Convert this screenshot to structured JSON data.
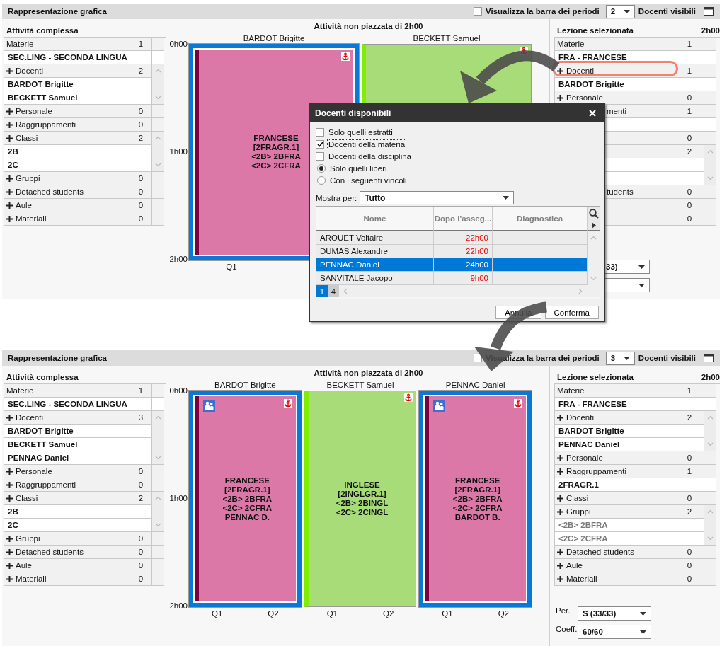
{
  "panels": [
    {
      "title": "Rappresentazione grafica",
      "periods_bar": {
        "label": "Visualizza la barra dei periodi",
        "checked": false
      },
      "teachers_count": "2",
      "teachers_label": "Docenti visibili",
      "left": {
        "title": "Attività complessa",
        "sections": [
          {
            "label": "Materie",
            "plus": false,
            "count": "1",
            "scroll": false,
            "items": [
              {
                "text": "SEC.LING - SECONDA LINGUA"
              }
            ]
          },
          {
            "label": "Docenti",
            "plus": true,
            "count": "2",
            "scroll": true,
            "items": [
              {
                "text": "BARDOT Brigitte"
              },
              {
                "text": "BECKETT Samuel"
              }
            ]
          },
          {
            "label": "Personale",
            "plus": true,
            "count": "0",
            "scroll": false
          },
          {
            "label": "Raggruppamenti",
            "plus": true,
            "count": "0",
            "scroll": false
          },
          {
            "label": "Classi",
            "plus": true,
            "count": "2",
            "scroll": true,
            "items": [
              {
                "text": "2B"
              },
              {
                "text": "2C"
              }
            ]
          },
          {
            "label": "Gruppi",
            "plus": true,
            "count": "0",
            "scroll": false
          },
          {
            "label": "Detached students",
            "plus": true,
            "count": "0",
            "scroll": false
          },
          {
            "label": "Aule",
            "plus": true,
            "count": "0",
            "scroll": false
          },
          {
            "label": "Materiali",
            "plus": true,
            "count": "0",
            "scroll": false
          }
        ]
      },
      "middle": {
        "title": "Attività non piazzata di 2h00",
        "times": [
          "0h00",
          "1h00",
          "2h00"
        ],
        "columns": [
          {
            "name": "BARDOT Brigitte",
            "block": {
              "kind": "framed",
              "color": "#dc78a8",
              "anchored": true,
              "group": false,
              "lines": [
                "FRANCESE",
                "[2FRAGR.1]",
                "<2B> 2BFRA",
                "<2C> 2CFRA"
              ]
            },
            "periods": [
              "Q1"
            ]
          },
          {
            "name": "BECKETT Samuel",
            "block": {
              "kind": "plain",
              "color": "#a8dc78",
              "anchored": true,
              "group": false
            }
          }
        ]
      },
      "right": {
        "title": "Lezione selezionata",
        "duration": "2h00",
        "sections": [
          {
            "label": "Materie",
            "plus": false,
            "covered": false,
            "count": "1",
            "scroll": false,
            "items": [
              {
                "text": "FRA - FRANCESE"
              }
            ]
          },
          {
            "label": "Docenti",
            "plus": true,
            "covered": false,
            "count": "1",
            "scroll": false,
            "items": [
              {
                "text": "BARDOT Brigitte"
              }
            ]
          },
          {
            "label": "Personale",
            "plus": true,
            "covered": false,
            "count": "0",
            "scroll": false
          },
          {
            "label": "menti",
            "covered": true,
            "count": "1",
            "scroll": false,
            "items": [
              {
                "kind": "hidden"
              }
            ]
          },
          {
            "count": "0",
            "scroll": false
          },
          {
            "count": "2",
            "scroll": true,
            "items": [
              {
                "kind": "hidden"
              },
              {
                "kind": "hidden"
              }
            ]
          },
          {
            "label": "tudents",
            "covered": true,
            "count": "0",
            "scroll": false
          },
          {
            "count": "0",
            "scroll": false
          },
          {
            "count": "0",
            "scroll": false
          }
        ],
        "fields": [
          {
            "covered": true,
            "value": "33)"
          },
          {
            "covered": true
          }
        ]
      }
    },
    {
      "title": "Rappresentazione grafica",
      "periods_bar": {
        "label": "Visualizza la barra dei periodi",
        "checked": false
      },
      "teachers_count": "3",
      "teachers_label": "Docenti visibili",
      "left": {
        "title": "Attività complessa",
        "sections": [
          {
            "label": "Materie",
            "plus": false,
            "count": "1",
            "scroll": false,
            "items": [
              {
                "text": "SEC.LING - SECONDA LINGUA"
              }
            ]
          },
          {
            "label": "Docenti",
            "plus": true,
            "count": "3",
            "scroll": true,
            "items": [
              {
                "text": "BARDOT Brigitte"
              },
              {
                "text": "BECKETT Samuel"
              },
              {
                "text": "PENNAC Daniel"
              }
            ]
          },
          {
            "label": "Personale",
            "plus": true,
            "count": "0",
            "scroll": false
          },
          {
            "label": "Raggruppamenti",
            "plus": true,
            "count": "0",
            "scroll": false
          },
          {
            "label": "Classi",
            "plus": true,
            "count": "2",
            "scroll": true,
            "items": [
              {
                "text": "2B"
              },
              {
                "text": "2C"
              }
            ]
          },
          {
            "label": "Gruppi",
            "plus": true,
            "count": "0",
            "scroll": false
          },
          {
            "label": "Detached students",
            "plus": true,
            "count": "0",
            "scroll": false
          },
          {
            "label": "Aule",
            "plus": true,
            "count": "0",
            "scroll": false
          },
          {
            "label": "Materiali",
            "plus": true,
            "count": "0",
            "scroll": false
          }
        ]
      },
      "middle": {
        "title": "Attività non piazzata di 2h00",
        "times": [
          "0h00",
          "1h00",
          "2h00"
        ],
        "columns": [
          {
            "name": "BARDOT Brigitte",
            "block": {
              "kind": "framed",
              "color": "#dc78a8",
              "anchored": true,
              "group": true,
              "lines": [
                "FRANCESE",
                "[2FRAGR.1]",
                "<2B> 2BFRA",
                "<2C> 2CFRA",
                "PENNAC D."
              ]
            },
            "periods": [
              "Q1",
              "Q2"
            ]
          },
          {
            "name": "BECKETT Samuel",
            "block": {
              "kind": "plain",
              "color": "#a8dc78",
              "anchored": true,
              "group": false,
              "lines": [
                "INGLESE",
                "[2INGLGR.1]",
                "<2B> 2BINGL",
                "<2C> 2CINGL"
              ]
            },
            "periods": [
              "Q1",
              "Q2"
            ]
          },
          {
            "name": "PENNAC Daniel",
            "block": {
              "kind": "framed",
              "color": "#dc78a8",
              "anchored": true,
              "group": true,
              "lines": [
                "FRANCESE",
                "[2FRAGR.1]",
                "<2B> 2BFRA",
                "<2C> 2CFRA",
                "BARDOT B."
              ]
            },
            "periods": [
              "Q1",
              "Q2"
            ]
          }
        ]
      },
      "right": {
        "title": "Lezione selezionata",
        "duration": "2h00",
        "sections": [
          {
            "label": "Materie",
            "plus": false,
            "covered": false,
            "count": "1",
            "scroll": false,
            "items": [
              {
                "text": "FRA - FRANCESE",
                "muted": false
              }
            ]
          },
          {
            "label": "Docenti",
            "plus": true,
            "covered": false,
            "count": "2",
            "scroll": true,
            "items": [
              {
                "text": "BARDOT Brigitte",
                "muted": false
              },
              {
                "text": "PENNAC Daniel",
                "muted": false
              }
            ]
          },
          {
            "label": "Personale",
            "plus": true,
            "covered": false,
            "count": "0",
            "scroll": false
          },
          {
            "label": "Raggruppamenti",
            "plus": true,
            "covered": false,
            "count": "1",
            "scroll": false,
            "items": [
              {
                "text": "2FRAGR.1",
                "muted": false
              }
            ]
          },
          {
            "label": "Classi",
            "plus": true,
            "covered": false,
            "count": "0",
            "scroll": false
          },
          {
            "label": "Gruppi",
            "plus": true,
            "covered": false,
            "count": "2",
            "scroll": true,
            "items": [
              {
                "text": "<2B> 2BFRA",
                "muted": true
              },
              {
                "text": "<2C> 2CFRA",
                "muted": true
              }
            ]
          },
          {
            "label": "Detached students",
            "plus": true,
            "covered": false,
            "count": "0",
            "scroll": false
          },
          {
            "label": "Aule",
            "plus": true,
            "covered": false,
            "count": "0",
            "scroll": false
          },
          {
            "label": "Materiali",
            "plus": true,
            "covered": false,
            "count": "0",
            "scroll": false
          }
        ],
        "fields": [
          {
            "covered": false,
            "label": "Per.",
            "value": "S (33/33)"
          },
          {
            "covered": false,
            "label": "Coeff.",
            "value": "60/60"
          }
        ]
      }
    }
  ],
  "dialog": {
    "title": "Docenti disponibili",
    "options": [
      {
        "kind": "checkbox",
        "label": "Solo quelli estratti",
        "checked": false,
        "focused": false
      },
      {
        "kind": "checkbox",
        "label": "Docenti della materia",
        "checked": true,
        "focused": true
      },
      {
        "kind": "checkbox",
        "label": "Docenti della disciplina",
        "checked": false,
        "focused": false
      },
      {
        "kind": "radio",
        "label": "Solo quelli liberi",
        "selected": true
      },
      {
        "kind": "radio",
        "label": "Con i seguenti vincoli",
        "selected": false
      }
    ],
    "show_by": {
      "label": "Mostra per:",
      "value": "Tutto"
    },
    "table": {
      "columns": [
        "Nome",
        "Dopo l'asseg...",
        "Diagnostica"
      ],
      "rows": [
        {
          "name": "AROUET Voltaire",
          "after": "22h00",
          "selected": false
        },
        {
          "name": "DUMAS Alexandre",
          "after": "22h00",
          "selected": false
        },
        {
          "name": "PENNAC Daniel",
          "after": "24h00",
          "selected": true
        },
        {
          "name": "SANVITALE Jacopo",
          "after": "9h00",
          "selected": false
        }
      ]
    },
    "pages": [
      {
        "label": "1",
        "selected": true
      },
      {
        "label": "4",
        "selected": false
      }
    ],
    "buttons": [
      "Annulla",
      "Conferma"
    ]
  }
}
